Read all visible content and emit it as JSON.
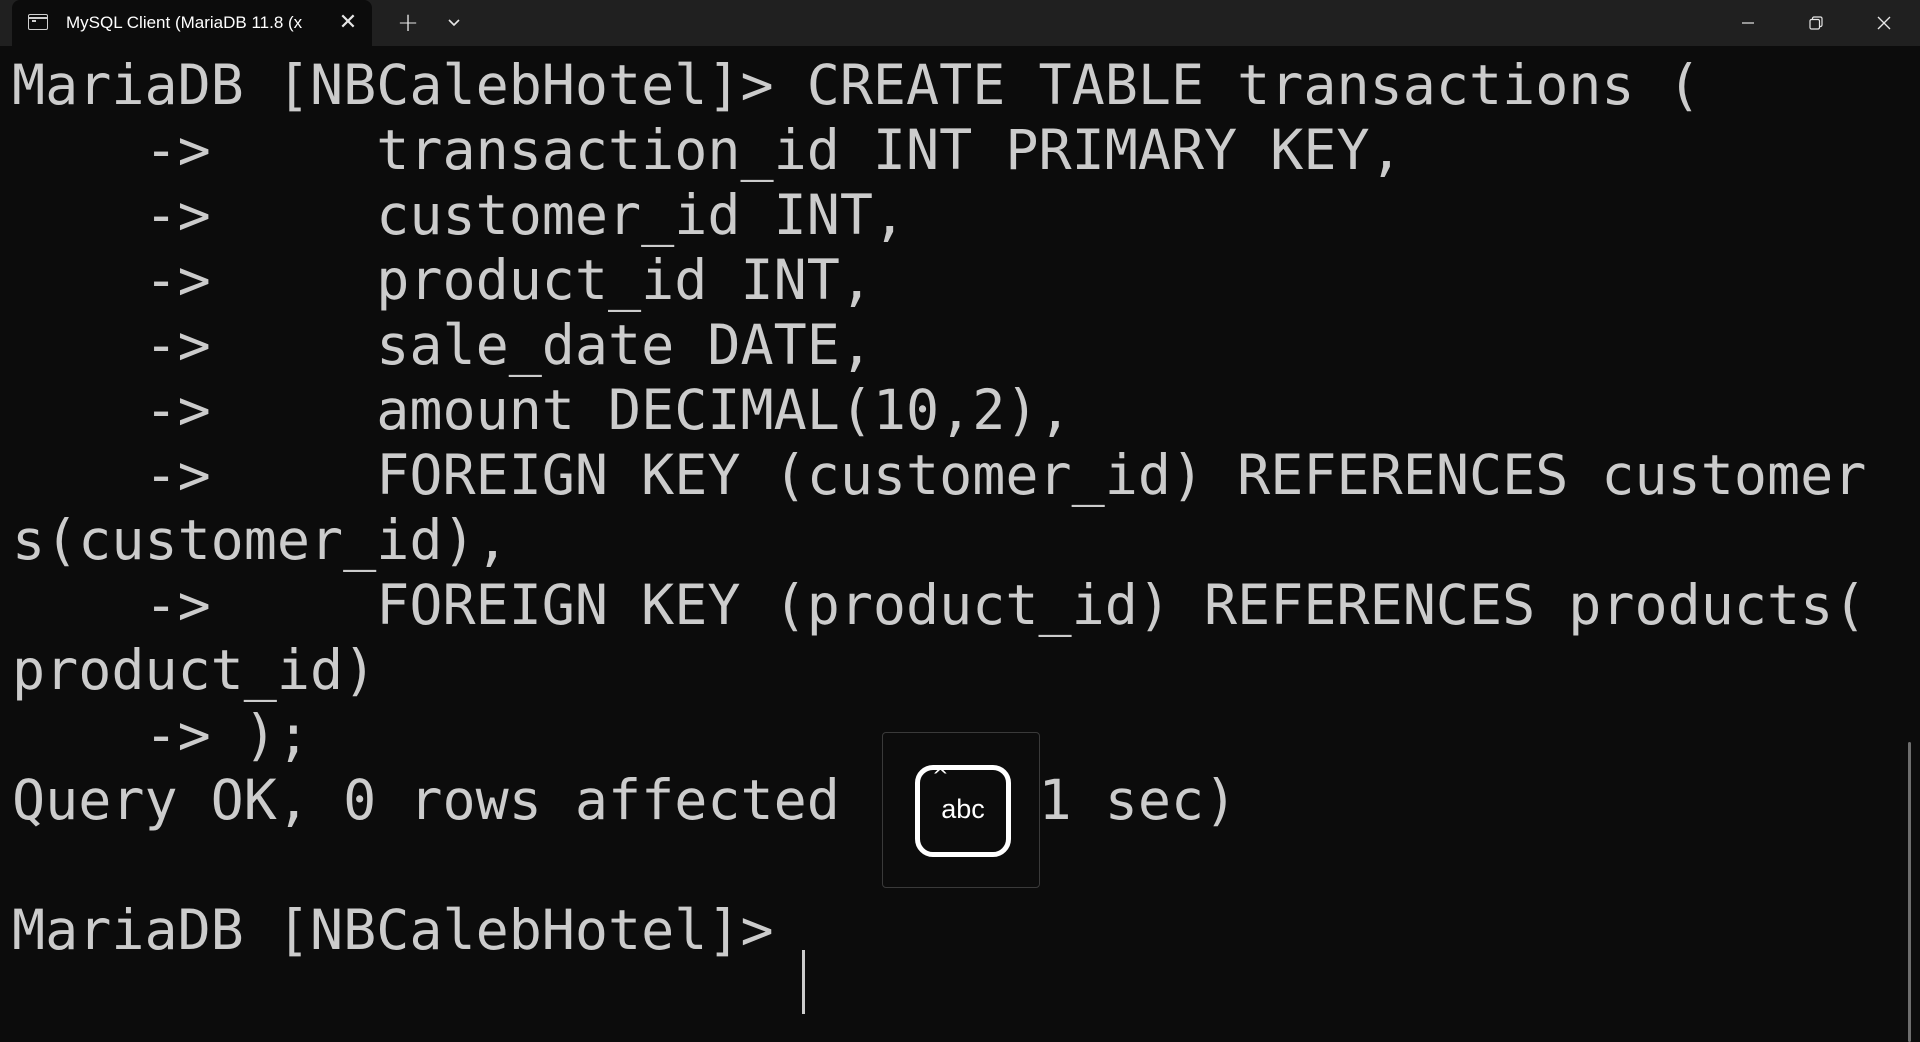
{
  "window": {
    "tab_title": "MySQL Client (MariaDB 11.8 (x",
    "tab_icon": "terminal-icon",
    "new_tab_label": "+",
    "close_tab_label": "✕"
  },
  "terminal": {
    "lines": [
      "MariaDB [NBCalebHotel]> CREATE TABLE transactions (",
      "    ->     transaction_id INT PRIMARY KEY,",
      "    ->     customer_id INT,",
      "    ->     product_id INT,",
      "    ->     sale_date DATE,",
      "    ->     amount DECIMAL(10,2),",
      "    ->     FOREIGN KEY (customer_id) REFERENCES customer",
      "s(customer_id),",
      "    ->     FOREIGN KEY (product_id) REFERENCES products(",
      "product_id)",
      "    -> );",
      "Query OK, 0 rows affected (0.011 sec)",
      "",
      "MariaDB [NBCalebHotel]> "
    ]
  },
  "ime": {
    "label": "abc",
    "caret": "^",
    "icon": "ime-input-mode-icon"
  },
  "colors": {
    "terminal_bg": "#0c0c0c",
    "terminal_fg": "#cccccc",
    "titlebar_bg": "#202020"
  }
}
